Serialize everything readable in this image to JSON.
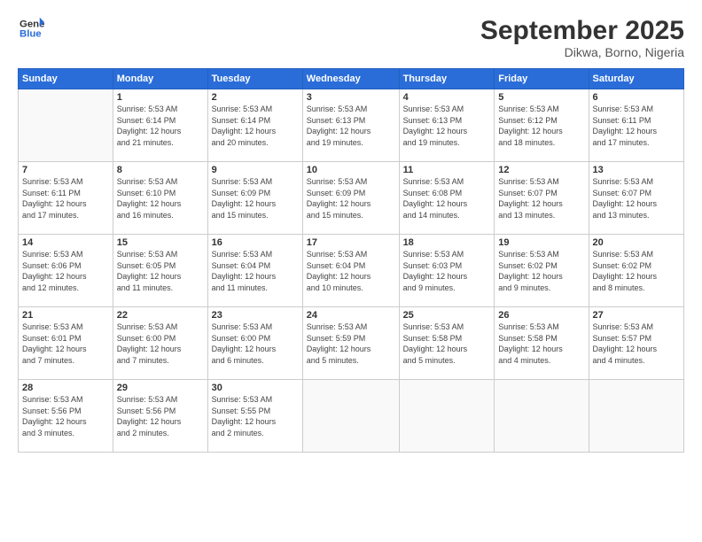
{
  "header": {
    "logo_general": "General",
    "logo_blue": "Blue",
    "title": "September 2025",
    "subtitle": "Dikwa, Borno, Nigeria"
  },
  "days_of_week": [
    "Sunday",
    "Monday",
    "Tuesday",
    "Wednesday",
    "Thursday",
    "Friday",
    "Saturday"
  ],
  "weeks": [
    [
      {
        "day": "",
        "info": ""
      },
      {
        "day": "1",
        "info": "Sunrise: 5:53 AM\nSunset: 6:14 PM\nDaylight: 12 hours\nand 21 minutes."
      },
      {
        "day": "2",
        "info": "Sunrise: 5:53 AM\nSunset: 6:14 PM\nDaylight: 12 hours\nand 20 minutes."
      },
      {
        "day": "3",
        "info": "Sunrise: 5:53 AM\nSunset: 6:13 PM\nDaylight: 12 hours\nand 19 minutes."
      },
      {
        "day": "4",
        "info": "Sunrise: 5:53 AM\nSunset: 6:13 PM\nDaylight: 12 hours\nand 19 minutes."
      },
      {
        "day": "5",
        "info": "Sunrise: 5:53 AM\nSunset: 6:12 PM\nDaylight: 12 hours\nand 18 minutes."
      },
      {
        "day": "6",
        "info": "Sunrise: 5:53 AM\nSunset: 6:11 PM\nDaylight: 12 hours\nand 17 minutes."
      }
    ],
    [
      {
        "day": "7",
        "info": "Sunrise: 5:53 AM\nSunset: 6:11 PM\nDaylight: 12 hours\nand 17 minutes."
      },
      {
        "day": "8",
        "info": "Sunrise: 5:53 AM\nSunset: 6:10 PM\nDaylight: 12 hours\nand 16 minutes."
      },
      {
        "day": "9",
        "info": "Sunrise: 5:53 AM\nSunset: 6:09 PM\nDaylight: 12 hours\nand 15 minutes."
      },
      {
        "day": "10",
        "info": "Sunrise: 5:53 AM\nSunset: 6:09 PM\nDaylight: 12 hours\nand 15 minutes."
      },
      {
        "day": "11",
        "info": "Sunrise: 5:53 AM\nSunset: 6:08 PM\nDaylight: 12 hours\nand 14 minutes."
      },
      {
        "day": "12",
        "info": "Sunrise: 5:53 AM\nSunset: 6:07 PM\nDaylight: 12 hours\nand 13 minutes."
      },
      {
        "day": "13",
        "info": "Sunrise: 5:53 AM\nSunset: 6:07 PM\nDaylight: 12 hours\nand 13 minutes."
      }
    ],
    [
      {
        "day": "14",
        "info": "Sunrise: 5:53 AM\nSunset: 6:06 PM\nDaylight: 12 hours\nand 12 minutes."
      },
      {
        "day": "15",
        "info": "Sunrise: 5:53 AM\nSunset: 6:05 PM\nDaylight: 12 hours\nand 11 minutes."
      },
      {
        "day": "16",
        "info": "Sunrise: 5:53 AM\nSunset: 6:04 PM\nDaylight: 12 hours\nand 11 minutes."
      },
      {
        "day": "17",
        "info": "Sunrise: 5:53 AM\nSunset: 6:04 PM\nDaylight: 12 hours\nand 10 minutes."
      },
      {
        "day": "18",
        "info": "Sunrise: 5:53 AM\nSunset: 6:03 PM\nDaylight: 12 hours\nand 9 minutes."
      },
      {
        "day": "19",
        "info": "Sunrise: 5:53 AM\nSunset: 6:02 PM\nDaylight: 12 hours\nand 9 minutes."
      },
      {
        "day": "20",
        "info": "Sunrise: 5:53 AM\nSunset: 6:02 PM\nDaylight: 12 hours\nand 8 minutes."
      }
    ],
    [
      {
        "day": "21",
        "info": "Sunrise: 5:53 AM\nSunset: 6:01 PM\nDaylight: 12 hours\nand 7 minutes."
      },
      {
        "day": "22",
        "info": "Sunrise: 5:53 AM\nSunset: 6:00 PM\nDaylight: 12 hours\nand 7 minutes."
      },
      {
        "day": "23",
        "info": "Sunrise: 5:53 AM\nSunset: 6:00 PM\nDaylight: 12 hours\nand 6 minutes."
      },
      {
        "day": "24",
        "info": "Sunrise: 5:53 AM\nSunset: 5:59 PM\nDaylight: 12 hours\nand 5 minutes."
      },
      {
        "day": "25",
        "info": "Sunrise: 5:53 AM\nSunset: 5:58 PM\nDaylight: 12 hours\nand 5 minutes."
      },
      {
        "day": "26",
        "info": "Sunrise: 5:53 AM\nSunset: 5:58 PM\nDaylight: 12 hours\nand 4 minutes."
      },
      {
        "day": "27",
        "info": "Sunrise: 5:53 AM\nSunset: 5:57 PM\nDaylight: 12 hours\nand 4 minutes."
      }
    ],
    [
      {
        "day": "28",
        "info": "Sunrise: 5:53 AM\nSunset: 5:56 PM\nDaylight: 12 hours\nand 3 minutes."
      },
      {
        "day": "29",
        "info": "Sunrise: 5:53 AM\nSunset: 5:56 PM\nDaylight: 12 hours\nand 2 minutes."
      },
      {
        "day": "30",
        "info": "Sunrise: 5:53 AM\nSunset: 5:55 PM\nDaylight: 12 hours\nand 2 minutes."
      },
      {
        "day": "",
        "info": ""
      },
      {
        "day": "",
        "info": ""
      },
      {
        "day": "",
        "info": ""
      },
      {
        "day": "",
        "info": ""
      }
    ]
  ]
}
